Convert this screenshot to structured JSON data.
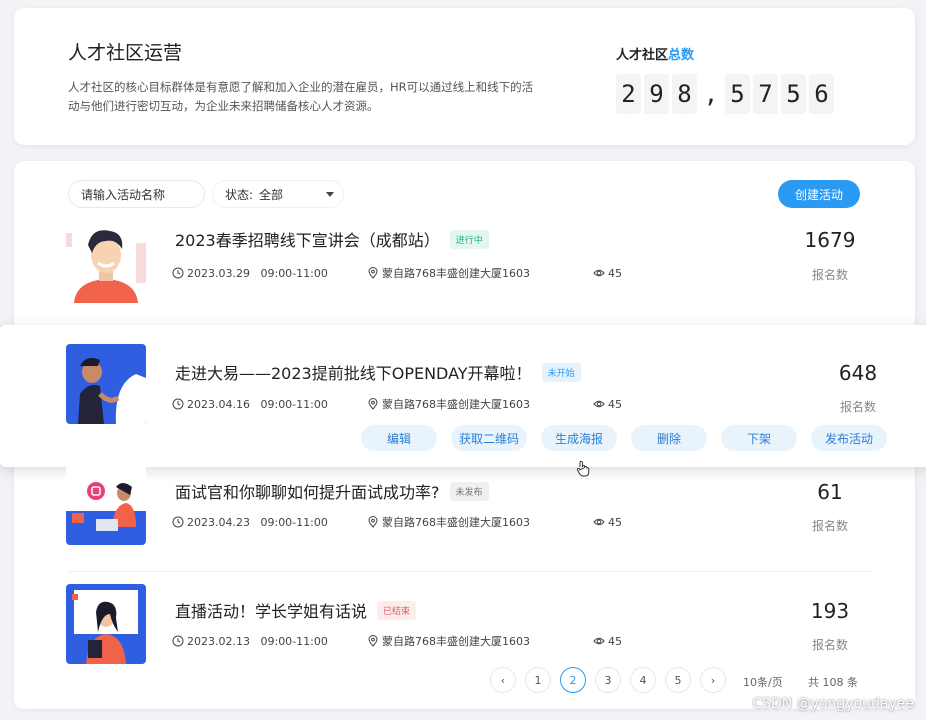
{
  "header": {
    "title": "人才社区运营",
    "description": "人才社区的核心目标群体是有意愿了解和加入企业的潜在雇员，HR可以通过线上和线下的活动与他们进行密切互动，为企业未来招聘储备核心人才资源。",
    "total_label_prefix": "人才社区",
    "total_label_highlight": "总数",
    "total_digits": [
      "2",
      "9",
      "8",
      ",",
      "5",
      "7",
      "5",
      "6"
    ]
  },
  "toolbar": {
    "search_value": "请输入活动名称",
    "status_label": "状态:",
    "status_value": "全部",
    "create_button": "创建活动"
  },
  "events": [
    {
      "title": "2023春季招聘线下宣讲会（成都站）",
      "status": "进行中",
      "status_color": "#21b07a",
      "status_bg": "#e4f7ee",
      "date": "2023.03.29",
      "time": "09:00-11:00",
      "address": "蒙自路768丰盛创建大厦1603",
      "views": "45",
      "count": "1679",
      "count_label": "报名数"
    },
    {
      "title": "走进大易——2023提前批线下OPENDAY开幕啦！",
      "status": "未开始",
      "status_color": "#2b9af3",
      "status_bg": "#e6f2fd",
      "date": "2023.04.16",
      "time": "09:00-11:00",
      "address": "蒙自路768丰盛创建大厦1603",
      "views": "45",
      "count": "648",
      "count_label": "报名数"
    },
    {
      "title": "面试官和你聊聊如何提升面试成功率?",
      "status": "未发布",
      "status_color": "#777777",
      "status_bg": "#f0f0f0",
      "date": "2023.04.23",
      "time": "09:00-11:00",
      "address": "蒙自路768丰盛创建大厦1603",
      "views": "45",
      "count": "61",
      "count_label": "报名数"
    },
    {
      "title": "直播活动！学长学姐有话说",
      "status": "已结束",
      "status_color": "#e55b5b",
      "status_bg": "#fdecec",
      "date": "2023.02.13",
      "time": "09:00-11:00",
      "address": "蒙自路768丰盛创建大厦1603",
      "views": "45",
      "count": "193",
      "count_label": "报名数"
    }
  ],
  "row_actions": [
    "编辑",
    "获取二维码",
    "生成海报",
    "删除",
    "下架",
    "发布活动"
  ],
  "pagination": {
    "pages": [
      "1",
      "2",
      "3",
      "4",
      "5"
    ],
    "current": "2",
    "page_size": "10条/页",
    "total": "共 108 条"
  },
  "watermark": "CSDN @yongyoudayee",
  "colors": {
    "accent": "#2b9af3",
    "background": "#f2f3f6"
  }
}
